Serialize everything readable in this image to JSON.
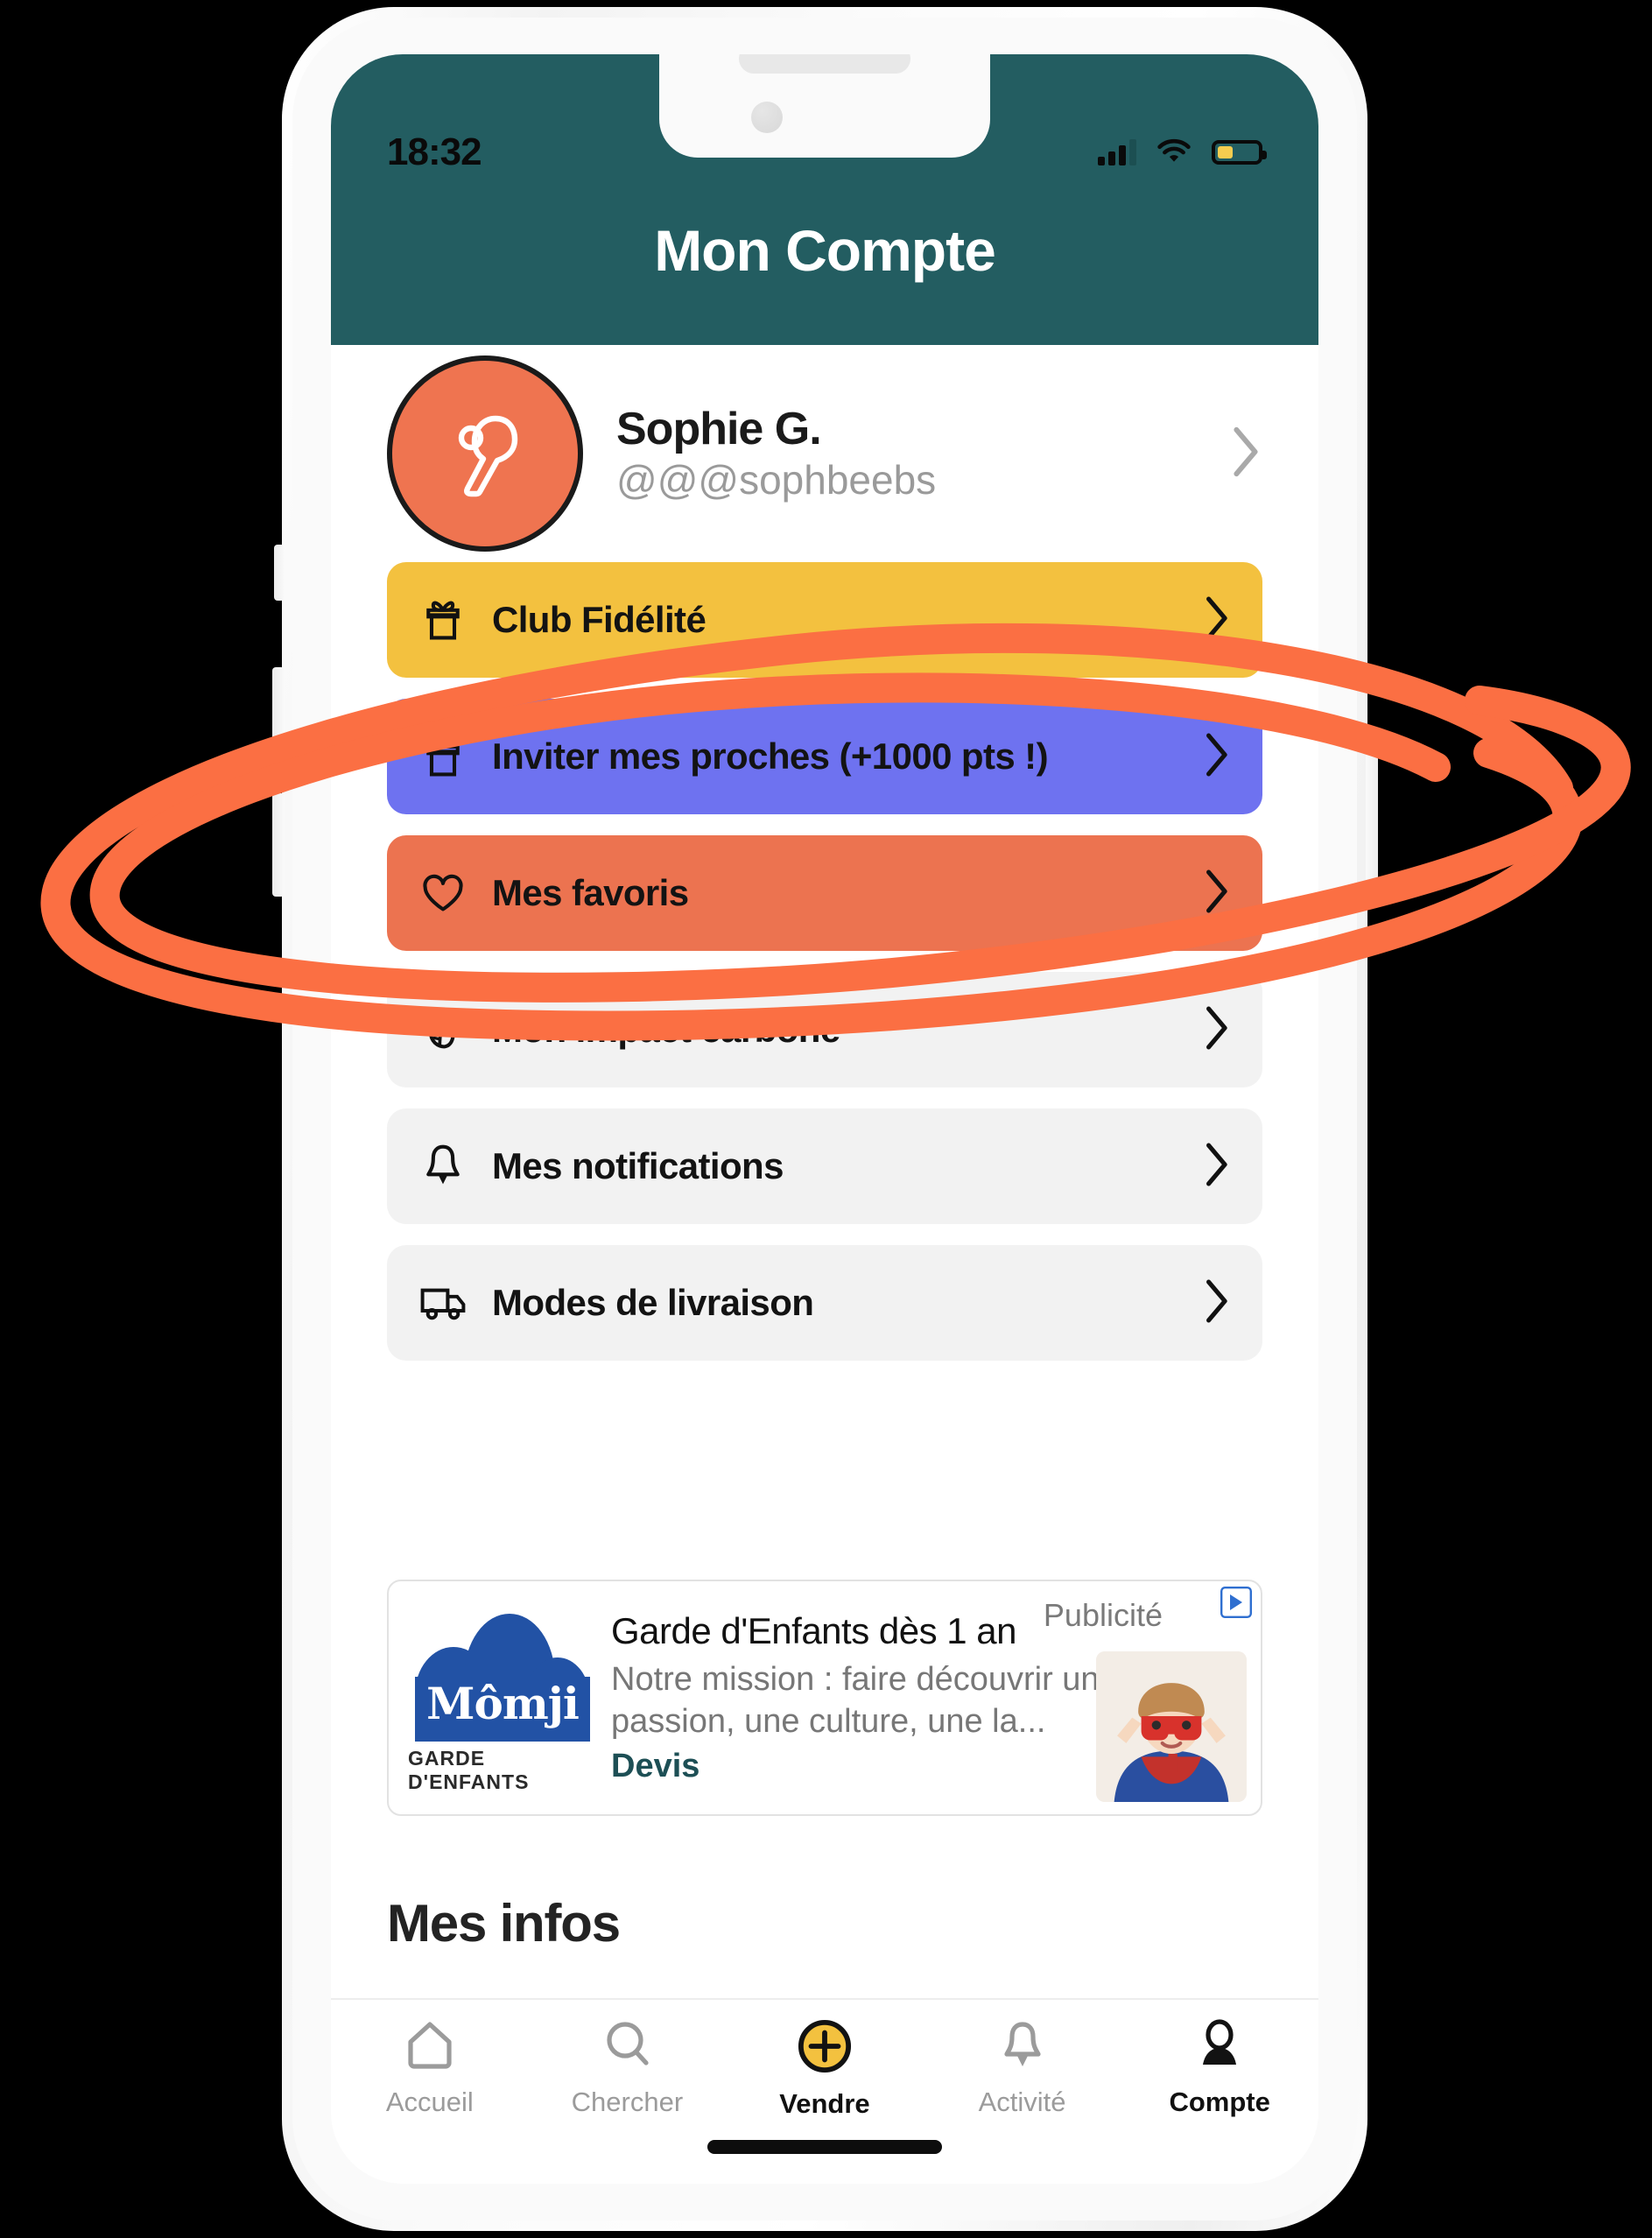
{
  "status_bar": {
    "time": "18:32",
    "signal_icon": "cellular-signal-icon",
    "wifi_icon": "wifi-icon",
    "battery_icon": "battery-icon",
    "battery_level_pct": 38
  },
  "header": {
    "title": "Mon Compte",
    "background_color": "#235d61",
    "title_color": "#ffffff"
  },
  "profile": {
    "name": "Sophie G.",
    "handle": "@@@sophbeebs",
    "avatar_icon": "user-silhouette-avatar",
    "avatar_color": "#ef7450",
    "chevron_icon": "chevron-right-icon"
  },
  "menu": {
    "items": [
      {
        "label": "Club Fidélité",
        "icon": "gift-icon",
        "style": "gold",
        "color": "#f3c13f"
      },
      {
        "label": "Inviter mes proches (+1000 pts !)",
        "icon": "gift-icon",
        "style": "indigo",
        "color": "#6e72f0"
      },
      {
        "label": "Mes favoris",
        "icon": "heart-icon",
        "style": "coral",
        "color": "#ec7350"
      },
      {
        "label": "Mon impact carbone",
        "icon": "leaf-icon",
        "style": "grey",
        "color": "#f2f2f2"
      },
      {
        "label": "Mes notifications",
        "icon": "bell-icon",
        "style": "grey",
        "color": "#f2f2f2"
      },
      {
        "label": "Modes de livraison",
        "icon": "truck-icon",
        "style": "grey",
        "color": "#f2f2f2"
      }
    ],
    "chevron_icon": "chevron-right-icon"
  },
  "ad": {
    "label": "Publicité",
    "advertiser": "Mômji",
    "advertiser_tagline": "GARDE D'ENFANTS",
    "headline": "Garde d'Enfants dès 1 an",
    "description": "Notre mission : faire découvrir une passion, une culture, une la...",
    "cta": "Devis",
    "adchoices_icon": "adchoices-icon",
    "thumbnail_alt": "child-in-superhero-costume"
  },
  "section": {
    "mes_infos_title": "Mes infos"
  },
  "tab_bar": {
    "tabs": [
      {
        "label": "Accueil",
        "icon": "home-icon",
        "active": false
      },
      {
        "label": "Chercher",
        "icon": "search-icon",
        "active": false
      },
      {
        "label": "Vendre",
        "icon": "plus-circle-icon",
        "active": true
      },
      {
        "label": "Activité",
        "icon": "bell-icon",
        "active": false
      },
      {
        "label": "Compte",
        "icon": "person-icon",
        "active": true
      }
    ],
    "accent_color": "#f3c13f"
  },
  "annotation": {
    "shape": "hand-drawn-double-ellipse",
    "color": "#fb6f43",
    "targets": "Inviter mes proches (+1000 pts !)"
  }
}
